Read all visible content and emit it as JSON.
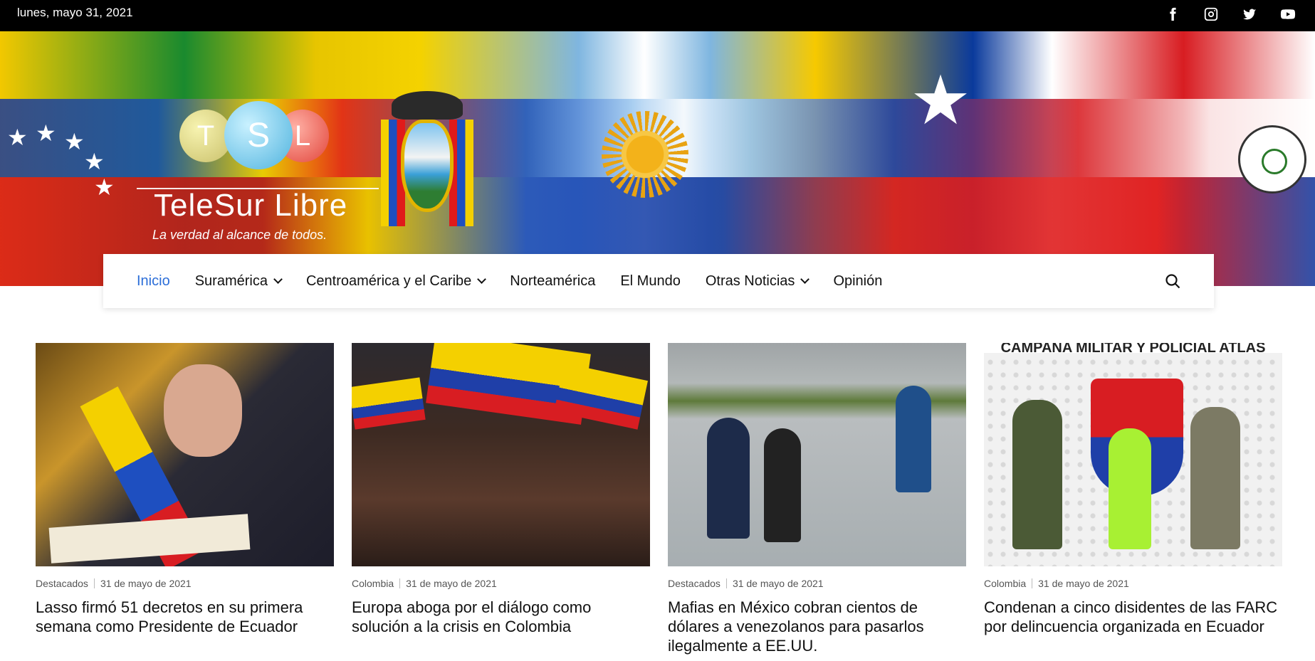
{
  "topbar": {
    "date": "lunes, mayo 31, 2021",
    "social": [
      "facebook-icon",
      "instagram-icon",
      "twitter-icon",
      "youtube-icon"
    ]
  },
  "logo": {
    "letters": [
      "T",
      "S",
      "L"
    ],
    "name": "TeleSur Libre",
    "tagline": "La verdad al alcance de todos."
  },
  "nav": {
    "items": [
      {
        "label": "Inicio",
        "active": true,
        "dropdown": false
      },
      {
        "label": "Suramérica",
        "active": false,
        "dropdown": true
      },
      {
        "label": "Centroamérica y el Caribe",
        "active": false,
        "dropdown": true
      },
      {
        "label": "Norteamérica",
        "active": false,
        "dropdown": false
      },
      {
        "label": "El Mundo",
        "active": false,
        "dropdown": false
      },
      {
        "label": "Otras Noticias",
        "active": false,
        "dropdown": true
      },
      {
        "label": "Opinión",
        "active": false,
        "dropdown": false
      }
    ],
    "active_color": "#2c6ed8"
  },
  "articles": [
    {
      "category": "Destacados",
      "date": "31 de mayo de 2021",
      "title": "Lasso firmó 51 decretos en su primera semana como Presidente de Ecuador"
    },
    {
      "category": "Colombia",
      "date": "31 de mayo de 2021",
      "title": "Europa aboga por el diálogo como solución a la crisis en Colombia"
    },
    {
      "category": "Destacados",
      "date": "31 de mayo de 2021",
      "title": "Mafias en México cobran cientos de dólares a venezolanos para pasarlos ilegalmente a EE.UU."
    },
    {
      "category": "Colombia",
      "date": "31 de mayo de 2021",
      "title": "Condenan a cinco disidentes de las FARC por delincuencia organizada en Ecuador"
    }
  ],
  "thumb4_text": "CAMPAÑA MILITAR Y POLICIAL  ATLAS"
}
